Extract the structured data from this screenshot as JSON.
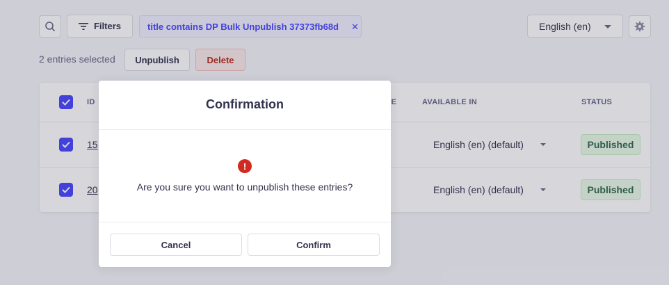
{
  "toolbar": {
    "search_icon": "search-icon",
    "filters_label": "Filters",
    "filter_tag": "title contains DP Bulk Unpublish 37373fb68d",
    "filter_remove_icon": "close-icon",
    "locale_value": "English (en)",
    "settings_icon": "gear-icon"
  },
  "bulk_actions": {
    "selected_text": "2 entries selected",
    "unpublish_label": "Unpublish",
    "delete_label": "Delete"
  },
  "table": {
    "headers": {
      "id": "ID",
      "name": "ME",
      "available_in": "AVAILABLE IN",
      "status": "STATUS"
    },
    "rows": [
      {
        "id": "15",
        "available_in": "English (en) (default)",
        "status": "Published",
        "checked": true
      },
      {
        "id": "20",
        "available_in": "English (en) (default)",
        "status": "Published",
        "checked": true
      }
    ]
  },
  "modal": {
    "title": "Confirmation",
    "icon": "warning-icon",
    "message": "Are you sure you want to unpublish these entries?",
    "cancel_label": "Cancel",
    "confirm_label": "Confirm"
  },
  "colors": {
    "primary": "#4945ff",
    "danger": "#d02b20",
    "success_text": "#2f6846",
    "success_bg": "#eafbe7"
  }
}
